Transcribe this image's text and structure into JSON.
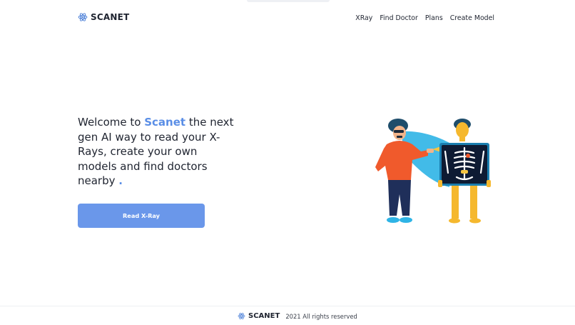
{
  "header": {
    "brand": "SCANET",
    "logo_icon": "atom-icon",
    "nav": [
      {
        "label": "XRay"
      },
      {
        "label": "Find Doctor"
      },
      {
        "label": "Plans"
      },
      {
        "label": "Create Model"
      }
    ]
  },
  "hero": {
    "text_before": "Welcome to ",
    "accent_word": "Scanet",
    "text_after": " the next gen AI way to read your X-Rays, create your own models and find doctors nearby ",
    "period": ".",
    "cta_label": "Read X-Ray",
    "illustration": "doctor-xray-illustration"
  },
  "footer": {
    "brand": "SCANET",
    "copyright": "2021 All rights reserved"
  },
  "colors": {
    "accent": "#5a8ee6",
    "button": "#6a97ea",
    "text": "#1f2430"
  }
}
